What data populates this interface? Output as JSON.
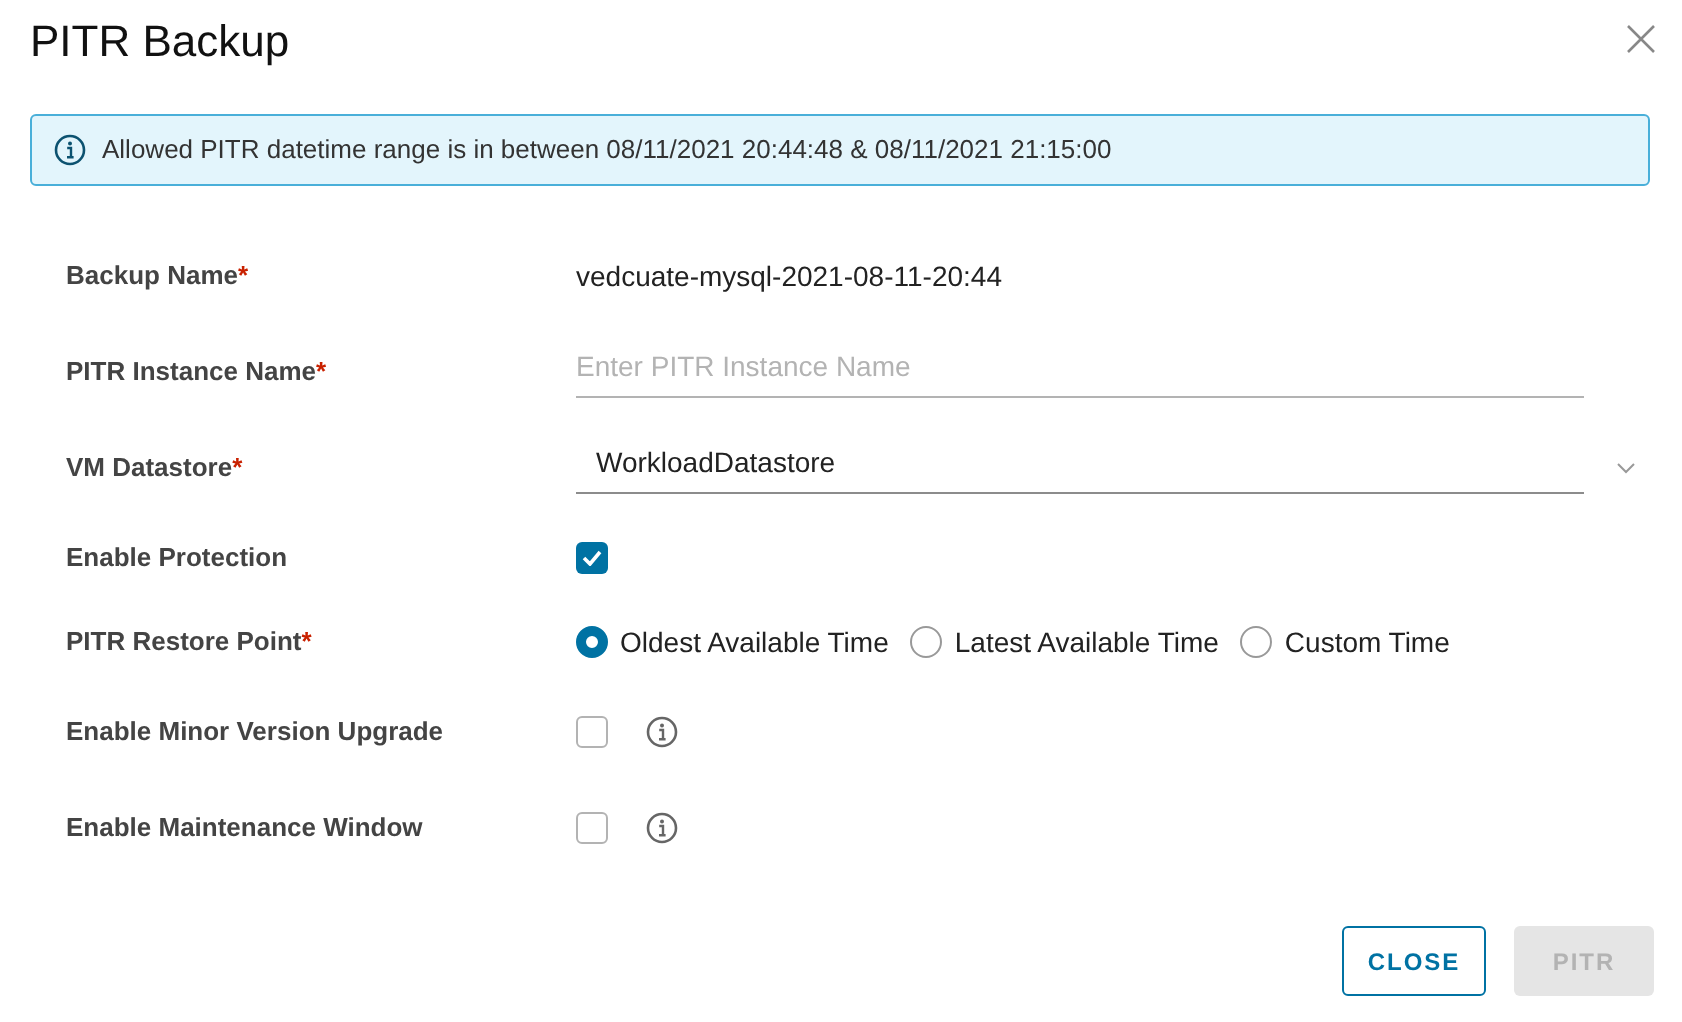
{
  "dialog": {
    "title": "PITR Backup"
  },
  "alert": {
    "text": "Allowed PITR datetime range is in between 08/11/2021 20:44:48 & 08/11/2021 21:15:00"
  },
  "fields": [
    {
      "kind": "text",
      "label": "Backup Name",
      "required_mark": "*",
      "value": "vedcuate-mysql-2021-08-11-20:44"
    },
    {
      "kind": "input",
      "label": "PITR Instance Name",
      "required_mark": "*",
      "placeholder": "Enter PITR Instance Name"
    },
    {
      "kind": "select",
      "label": "VM Datastore",
      "required_mark": "*",
      "value": "WorkloadDatastore"
    },
    {
      "kind": "checkbox",
      "label": "Enable Protection",
      "checked": true,
      "info": false
    },
    {
      "kind": "radio",
      "label": "PITR Restore Point",
      "required_mark": "*",
      "options": [
        {
          "label": "Oldest Available Time",
          "selected": true
        },
        {
          "label": "Latest Available Time",
          "selected": false
        },
        {
          "label": "Custom Time",
          "selected": false
        }
      ]
    },
    {
      "kind": "checkbox",
      "label": "Enable Minor Version Upgrade",
      "checked": false,
      "info": true
    },
    {
      "kind": "checkbox",
      "label": "Enable Maintenance Window",
      "checked": false,
      "info": true
    }
  ],
  "buttons": [
    {
      "label": "CLOSE",
      "disabled": false
    },
    {
      "label": "PITR",
      "disabled": true
    }
  ]
}
